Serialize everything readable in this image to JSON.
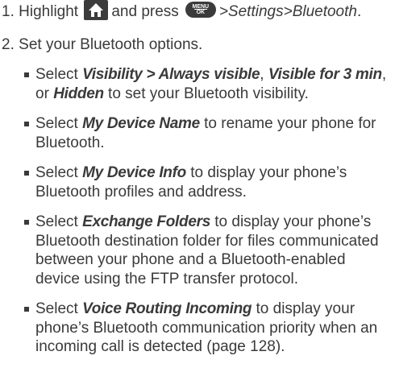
{
  "step1": {
    "number": "1.",
    "highlight": "Highlight",
    "and_press": "and press",
    "path_settings": "Settings",
    "path_bluetooth": "Bluetooth",
    "period": ".",
    "home_key_icon": "home-key-icon",
    "menu_key": {
      "top": "MENU",
      "bottom": "OK"
    }
  },
  "step2": {
    "number": "2.",
    "text": "Set your Bluetooth options."
  },
  "bullets": [
    {
      "pre": "Select ",
      "b1": "Visibility",
      "sep1": " > ",
      "b2": "Always visible",
      "mid1": ", ",
      "b3": "Visible for 3 min",
      "mid2": ", or ",
      "b4": "Hidden",
      "post": " to set your Bluetooth visibility."
    },
    {
      "pre": "Select ",
      "b1": "My Device Name",
      "post": " to rename your phone for Bluetooth."
    },
    {
      "pre": "Select ",
      "b1": "My Device Info",
      "post": " to display your phone’s Bluetooth profiles and address."
    },
    {
      "pre": "Select ",
      "b1": "Exchange Folders",
      "post": " to display your phone’s Bluetooth destination folder for files communicated between your phone and a Bluetooth-enabled device using the FTP transfer protocol."
    },
    {
      "pre": "Select ",
      "b1": "Voice Routing Incoming",
      "post": " to display your phone’s Bluetooth communication priority when an incoming call is detected (page 128)."
    }
  ]
}
